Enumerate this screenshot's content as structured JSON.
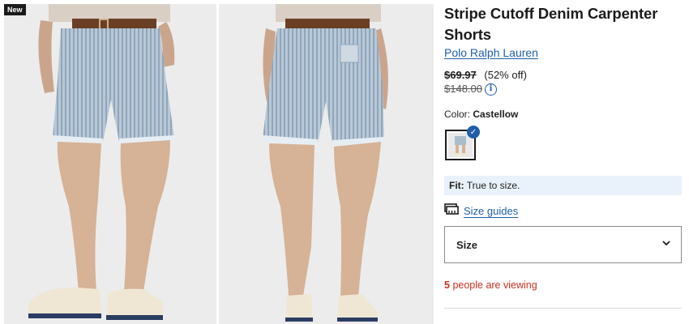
{
  "gallery": {
    "badge": "New",
    "images": [
      {
        "view": "front",
        "alt": "front view"
      },
      {
        "view": "back",
        "alt": "back view"
      }
    ]
  },
  "product": {
    "title": "Stripe Cutoff Denim Carpenter Shorts",
    "brand": "Polo Ralph Lauren",
    "sale_price": "$69.97",
    "discount": "(52% off)",
    "original_price": "$148.00",
    "info_icon": "info-icon"
  },
  "color": {
    "label": "Color:",
    "name": "Castellow",
    "selected_check": "✓"
  },
  "fit": {
    "label": "Fit:",
    "text": "True to size."
  },
  "size_guides": {
    "icon": "ruler-icon",
    "label": "Size guides"
  },
  "size_select": {
    "label": "Size",
    "icon": "chevron-down-icon"
  },
  "viewing": {
    "count": "5",
    "text": "people are viewing"
  },
  "colors": {
    "link": "#1f5fa8",
    "alert": "#c7321f",
    "fit_bg": "#e9f1fb"
  }
}
